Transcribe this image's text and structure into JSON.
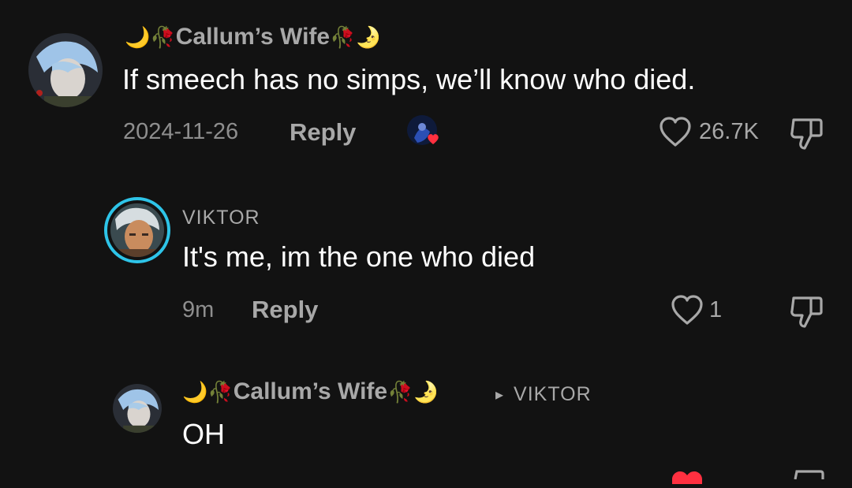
{
  "comments": [
    {
      "username": "Callum’s Wife",
      "username_prefix_emoji": "🌙🥀",
      "username_suffix_emoji": "🥀🌛",
      "text": "If smeech has no simps, we’ll know who died.",
      "date": "2024-11-26",
      "reply_label": "Reply",
      "likes": "26.7K"
    },
    {
      "username": "VIKTOR",
      "text": "It's me, im the one who died",
      "date": "9m",
      "reply_label": "Reply",
      "likes": "1"
    },
    {
      "username": "Callum’s Wife",
      "username_prefix_emoji": "🌙🥀",
      "username_suffix_emoji": "🥀🌛",
      "reply_to_arrow": "▸",
      "reply_to": "VIKTOR",
      "text": "OH"
    }
  ],
  "colors": {
    "background": "#121212",
    "text_primary": "#ffffff",
    "text_secondary": "#a8a8a8",
    "story_ring": "#2ec4e8",
    "like_active": "#ff3040"
  }
}
